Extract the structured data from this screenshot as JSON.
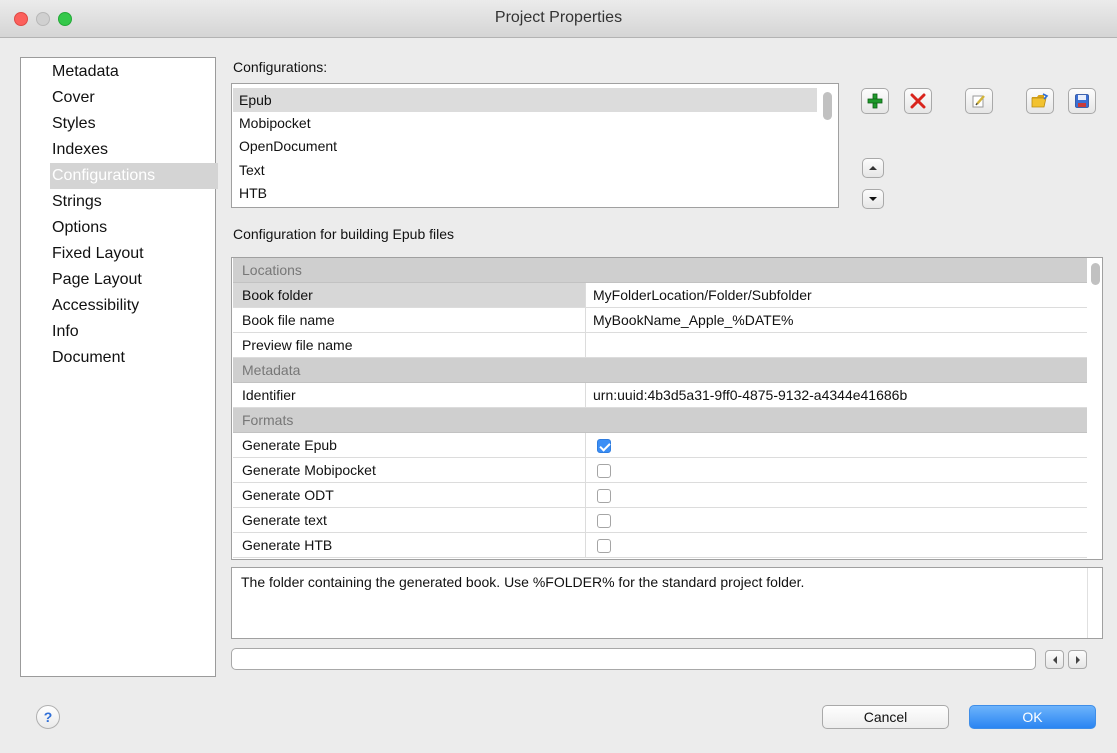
{
  "window": {
    "title": "Project Properties"
  },
  "sidebar": {
    "items": [
      {
        "label": "Metadata"
      },
      {
        "label": "Cover"
      },
      {
        "label": "Styles"
      },
      {
        "label": "Indexes"
      },
      {
        "label": "Configurations",
        "selected": true
      },
      {
        "label": "Strings"
      },
      {
        "label": "Options"
      },
      {
        "label": "Fixed Layout"
      },
      {
        "label": "Page Layout"
      },
      {
        "label": "Accessibility"
      },
      {
        "label": "Info"
      },
      {
        "label": "Document"
      }
    ]
  },
  "configurations": {
    "label": "Configurations:",
    "items": [
      {
        "label": "Epub",
        "selected": true
      },
      {
        "label": "Mobipocket"
      },
      {
        "label": "OpenDocument"
      },
      {
        "label": "Text"
      },
      {
        "label": "HTB"
      }
    ],
    "toolbar": [
      "add-icon",
      "delete-icon",
      "edit-icon",
      "open-folder-icon",
      "save-icon"
    ],
    "move": [
      "move-up-icon",
      "move-down-icon"
    ]
  },
  "details": {
    "label": "Configuration for building Epub files",
    "rows": [
      {
        "type": "category",
        "key": "Locations"
      },
      {
        "type": "text",
        "key": "Book folder",
        "value": "MyFolderLocation/Folder/Subfolder",
        "selected": true
      },
      {
        "type": "text",
        "key": "Book file name",
        "value": "MyBookName_Apple_%DATE%"
      },
      {
        "type": "text",
        "key": "Preview file name",
        "value": ""
      },
      {
        "type": "category",
        "key": "Metadata"
      },
      {
        "type": "text",
        "key": "Identifier",
        "value": "urn:uuid:4b3d5a31-9ff0-4875-9132-a4344e41686b"
      },
      {
        "type": "category",
        "key": "Formats"
      },
      {
        "type": "check",
        "key": "Generate Epub",
        "checked": true
      },
      {
        "type": "check",
        "key": "Generate Mobipocket",
        "checked": false
      },
      {
        "type": "check",
        "key": "Generate ODT",
        "checked": false
      },
      {
        "type": "check",
        "key": "Generate text",
        "checked": false
      },
      {
        "type": "check",
        "key": "Generate HTB",
        "checked": false
      }
    ]
  },
  "description": "The folder containing the generated book. Use %FOLDER% for the standard project folder.",
  "footer": {
    "help": "?",
    "cancel": "Cancel",
    "ok": "OK"
  },
  "colors": {
    "accent": "#2a85f2",
    "selection": "#d4d4d4",
    "add": "#1e9a2b",
    "delete": "#d9241c"
  }
}
